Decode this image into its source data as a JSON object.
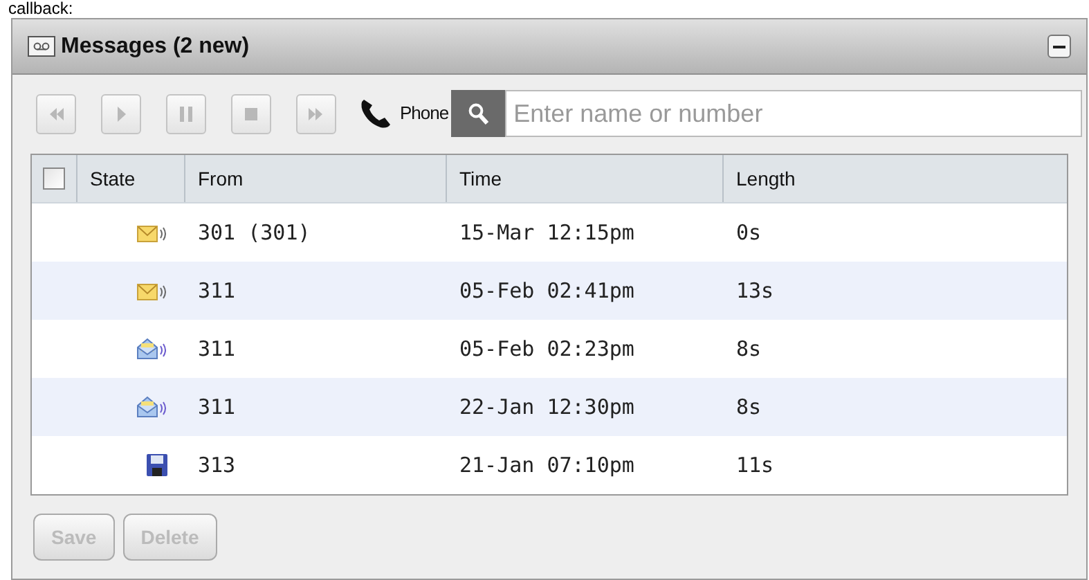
{
  "caption": "callback:",
  "panel": {
    "title": "Messages (2 new)",
    "expanded": true
  },
  "toolbar": {
    "controls": [
      {
        "kind": "rewind",
        "disabled": true
      },
      {
        "kind": "play",
        "disabled": true
      },
      {
        "kind": "pause",
        "disabled": true
      },
      {
        "kind": "stop",
        "disabled": true
      },
      {
        "kind": "forward",
        "disabled": true
      }
    ],
    "phone_label": "Phone",
    "search": {
      "placeholder": "Enter name or number"
    }
  },
  "table": {
    "select_all": {
      "checked": false
    },
    "columns": [
      "State",
      "From",
      "Time",
      "Length"
    ],
    "rows": [
      {
        "kind": "new",
        "from": "301 (301)",
        "time": "15-Mar 12:15pm",
        "length": "0s",
        "checked": false
      },
      {
        "kind": "new",
        "from": "311",
        "time": "05-Feb 02:41pm",
        "length": "13s",
        "checked": false
      },
      {
        "kind": "heard",
        "from": "311",
        "time": "05-Feb 02:23pm",
        "length": "8s",
        "checked": false
      },
      {
        "kind": "heard",
        "from": "311",
        "time": "22-Jan 12:30pm",
        "length": "8s",
        "checked": false
      },
      {
        "kind": "saved",
        "from": "313",
        "time": "21-Jan 07:10pm",
        "length": "11s",
        "checked": false
      }
    ]
  },
  "buttons": [
    {
      "label": "Save",
      "disabled": true
    },
    {
      "label": "Delete",
      "disabled": true
    }
  ]
}
